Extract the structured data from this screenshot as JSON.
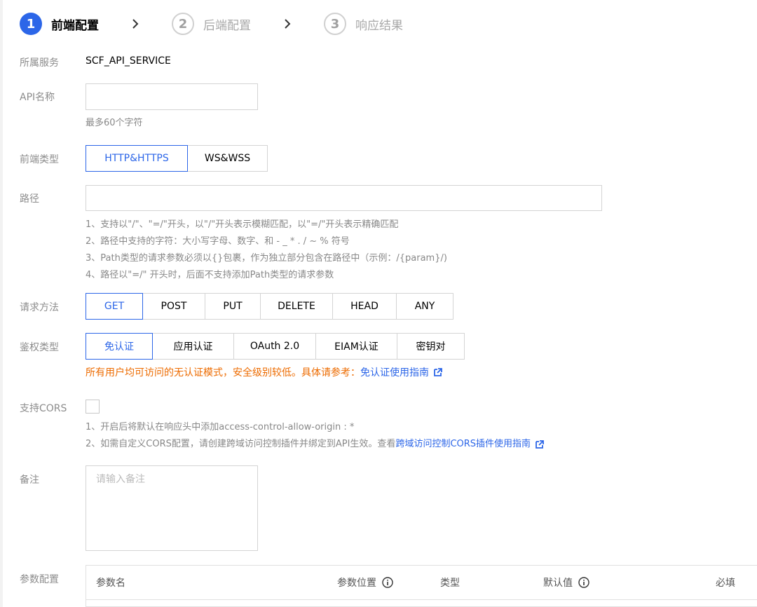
{
  "steps": [
    {
      "num": "1",
      "label": "前端配置"
    },
    {
      "num": "2",
      "label": "后端配置"
    },
    {
      "num": "3",
      "label": "响应结果"
    }
  ],
  "service": {
    "label": "所属服务",
    "value": "SCF_API_SERVICE"
  },
  "api_name": {
    "label": "API名称",
    "value": "",
    "hint": "最多60个字符"
  },
  "frontend_type": {
    "label": "前端类型",
    "options": [
      "HTTP&HTTPS",
      "WS&WSS"
    ],
    "selected": "HTTP&HTTPS"
  },
  "path": {
    "label": "路径",
    "value": "",
    "hints": [
      "1、支持以\"/\"、\"=/\"开头，以\"/\"开头表示模糊匹配，以\"=/\"开头表示精确匹配",
      "2、路径中支持的字符：大小写字母、数字、和 - _ * . / ~ % 符号",
      "3、Path类型的请求参数必须以{}包裹，作为独立部分包含在路径中（示例：/{param}/)",
      "4、路径以\"=/\" 开头时，后面不支持添加Path类型的请求参数"
    ]
  },
  "method": {
    "label": "请求方法",
    "options": [
      "GET",
      "POST",
      "PUT",
      "DELETE",
      "HEAD",
      "ANY"
    ],
    "selected": "GET"
  },
  "auth": {
    "label": "鉴权类型",
    "options": [
      "免认证",
      "应用认证",
      "OAuth 2.0",
      "EIAM认证",
      "密钥对"
    ],
    "selected": "免认证",
    "notice": "所有用户均可访问的无认证模式，安全级别较低。具体请参考：",
    "notice_link": "免认证使用指南"
  },
  "cors": {
    "label": "支持CORS",
    "checked": false,
    "hint1": "1、开启后将默认在响应头中添加access-control-allow-origin : *",
    "hint2": "2、如需自定义CORS配置，请创建跨域访问控制插件并绑定到API生效。查看",
    "hint2_link": "跨域访问控制CORS插件使用指南"
  },
  "remark": {
    "label": "备注",
    "placeholder": "请输入备注"
  },
  "params": {
    "label": "参数配置",
    "columns": [
      "参数名",
      "参数位置",
      "类型",
      "默认值",
      "必填"
    ]
  },
  "colors": {
    "accent": "#2c66e8",
    "warning": "#ed6b00"
  }
}
